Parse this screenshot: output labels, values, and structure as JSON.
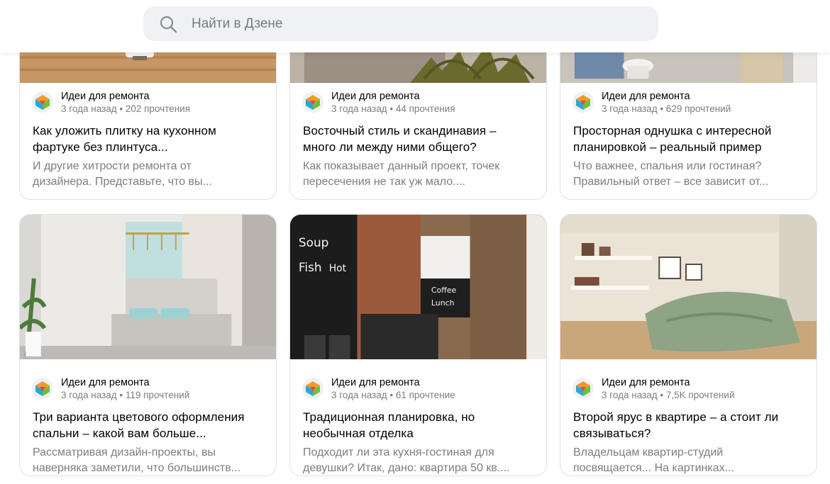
{
  "search": {
    "placeholder": "Найти в Дзене"
  },
  "cards": [
    {
      "channel": "Идеи для ремонта",
      "stats": "3 года назад • 202 прочтения",
      "title_line1": "Как уложить плитку на кухонном",
      "title_line2": "фартуке без плинтуса...",
      "snippet_line1": "И другие хитрости ремонта от",
      "snippet_line2": "дизайнера. Представьте, что вы..."
    },
    {
      "channel": "Идеи для ремонта",
      "stats": "3 года назад • 44 прочтения",
      "title_line1": "Восточный стиль и скандинавия –",
      "title_line2": "много ли между ними общего?",
      "snippet_line1": "Как показывает данный проект, точек",
      "snippet_line2": "пересечения не так уж мало...."
    },
    {
      "channel": "Идеи для ремонта",
      "stats": "3 года назад • 629 прочтений",
      "title_line1": "Просторная однушка с интересной",
      "title_line2": "планировкой – реальный пример",
      "snippet_line1": "Что важнее, спальня или гостиная?",
      "snippet_line2": "Правильный ответ – все зависит от..."
    },
    {
      "channel": "Идеи для ремонта",
      "stats": "3 года назад • 119 прочтений",
      "title_line1": "Три варианта цветового оформления",
      "title_line2": "спальни – какой вам больше...",
      "snippet_line1": "Рассматривая дизайн-проекты, вы",
      "snippet_line2": "наверняка заметили, что большинств..."
    },
    {
      "channel": "Идеи для ремонта",
      "stats": "3 года назад • 61 прочтение",
      "title_line1": "Традиционная планировка, но",
      "title_line2": "необычная отделка",
      "snippet_line1": "Подходит ли эта кухня-гостиная для",
      "snippet_line2": "девушки? Итак, дано: квартира 50 кв...."
    },
    {
      "channel": "Идеи для ремонта",
      "stats": "3 года назад • 7,5K прочтений",
      "title_line1": "Второй ярус в квартире – а стоит ли",
      "title_line2": "связываться?",
      "snippet_line1": "Владельцам квартир-студий",
      "snippet_line2": "посвящается... На картинках..."
    }
  ],
  "kitchen_image_text": {
    "w1": "Soup",
    "w2": "Fish",
    "w3": "Hot",
    "w4": "Coffee",
    "w5": "Lunch"
  }
}
